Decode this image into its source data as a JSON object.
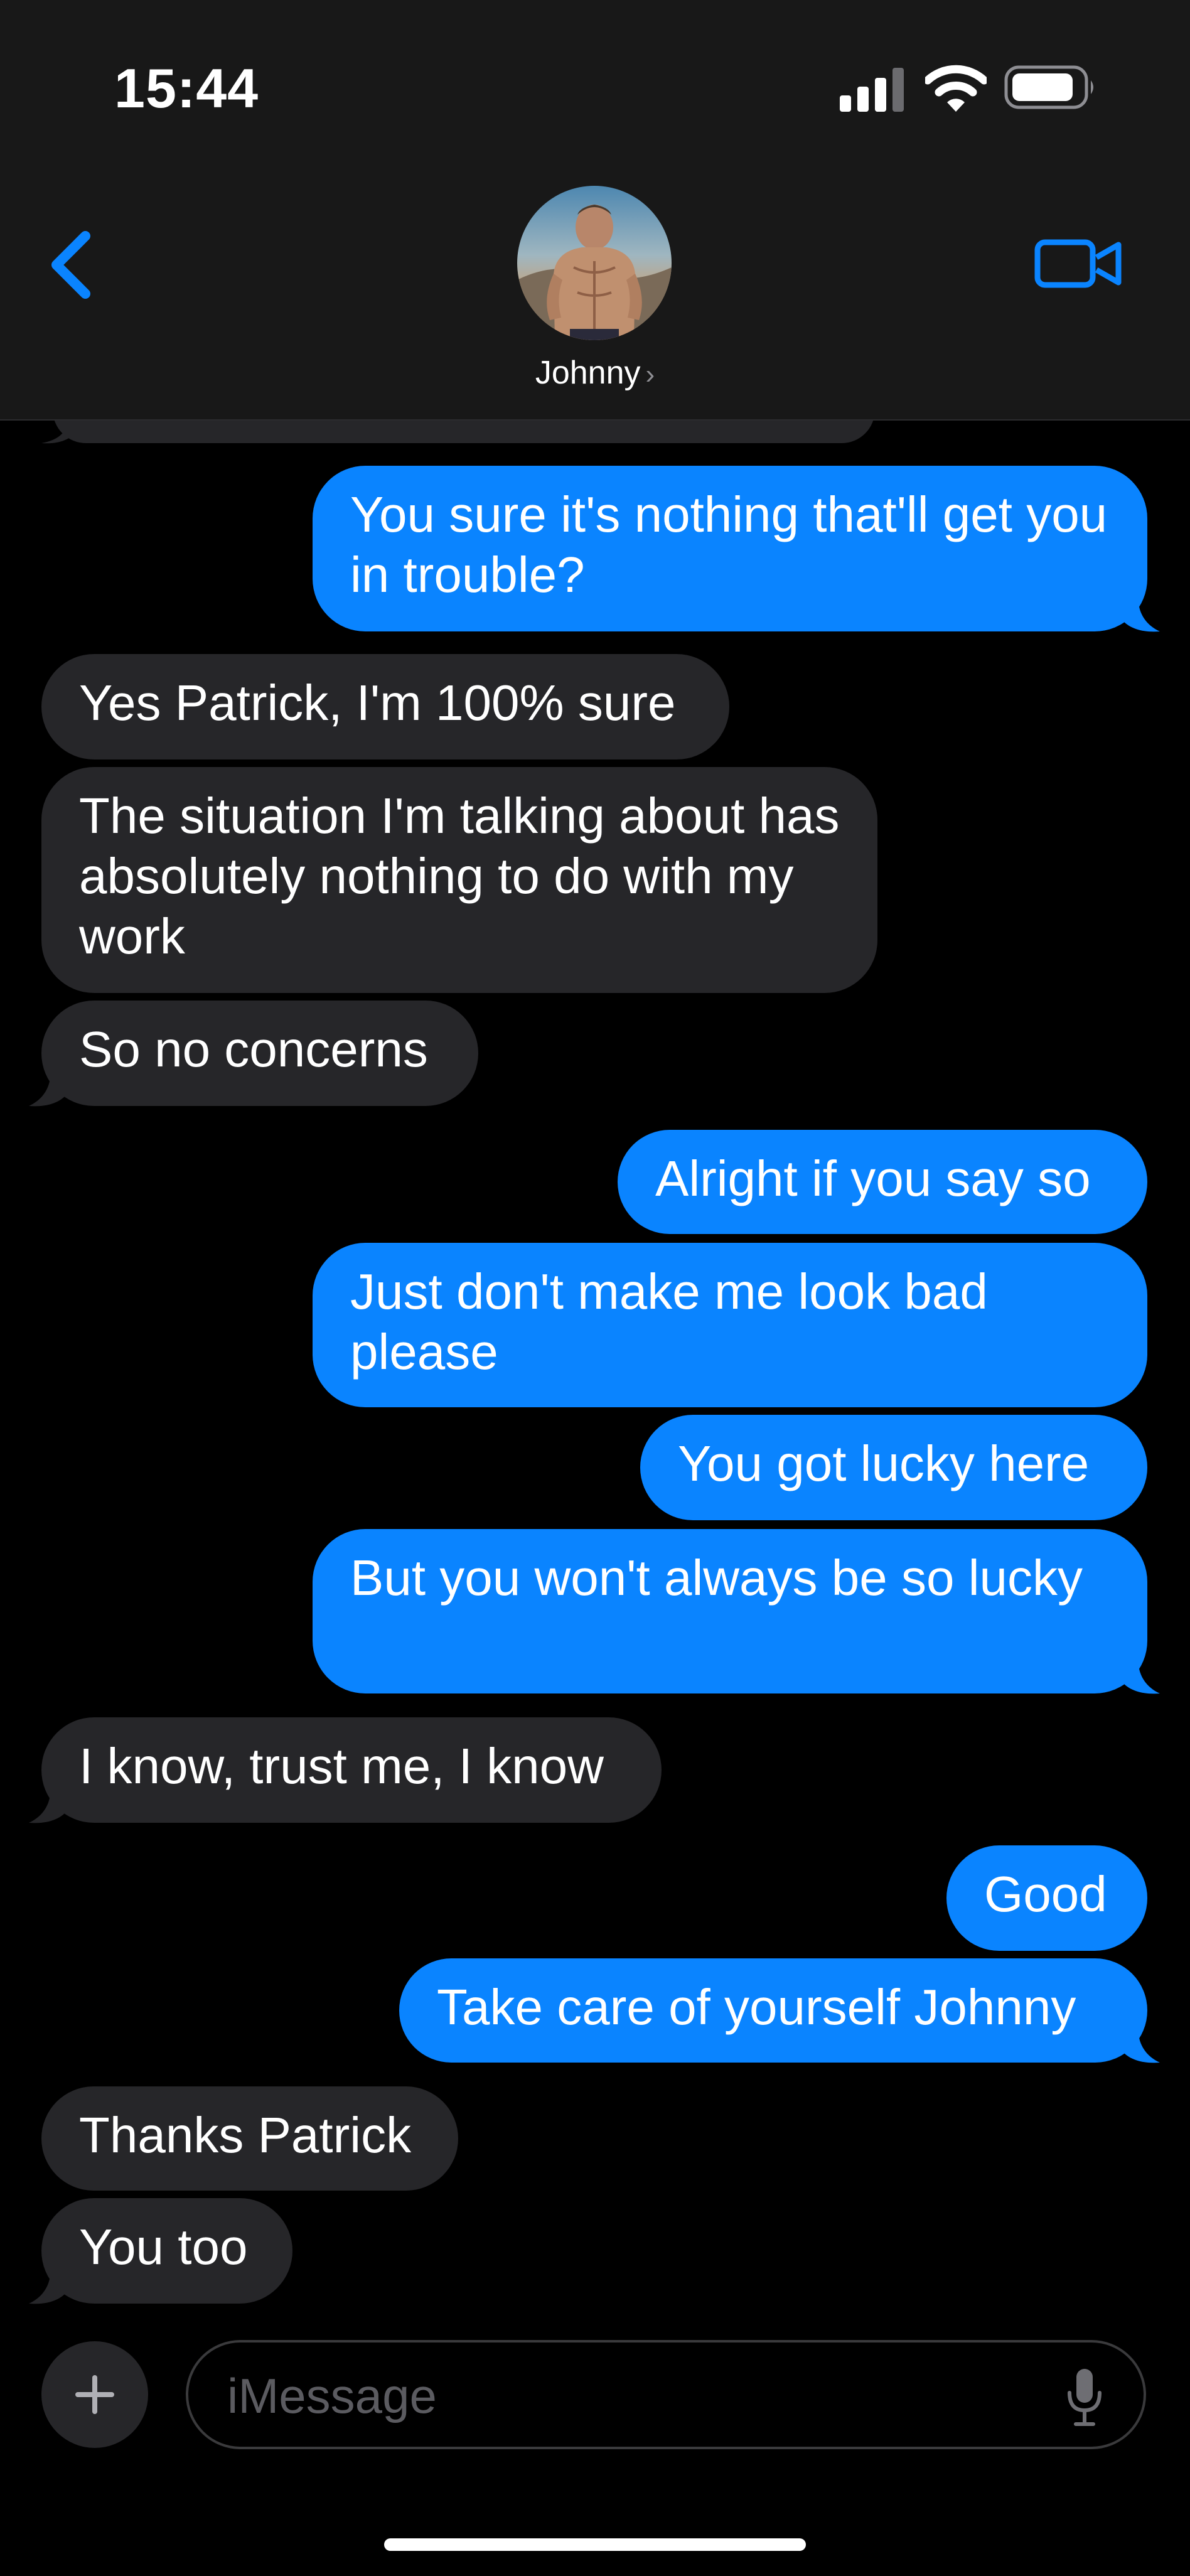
{
  "status_bar": {
    "time": "15:44"
  },
  "header": {
    "contact_name": "Johnny"
  },
  "messages": [
    {
      "dir": "out",
      "text": "You sure it's nothing that'll get you in trouble?"
    },
    {
      "dir": "in",
      "text": "Yes Patrick, I'm 100% sure"
    },
    {
      "dir": "in",
      "text": "The situation I'm talking about has absolutely nothing to do with my work"
    },
    {
      "dir": "in",
      "text": "So no concerns"
    },
    {
      "dir": "out",
      "text": "Alright if you say so"
    },
    {
      "dir": "out",
      "text": "Just don't make me look bad please"
    },
    {
      "dir": "out",
      "text": "You got lucky here"
    },
    {
      "dir": "out",
      "text": "But you won't always be so lucky"
    },
    {
      "dir": "in",
      "text": "I know, trust me, I know"
    },
    {
      "dir": "out",
      "text": "Good"
    },
    {
      "dir": "out",
      "text": "Take care of yourself Johnny"
    },
    {
      "dir": "in",
      "text": "Thanks Patrick"
    },
    {
      "dir": "in",
      "text": "You too"
    }
  ],
  "composer": {
    "placeholder": "iMessage"
  },
  "icons": {
    "back": "chevron-left-icon",
    "video": "video-camera-icon",
    "plus": "plus-icon",
    "mic": "microphone-icon"
  },
  "colors": {
    "accent": "#0a84ff",
    "incoming_bubble": "#262629",
    "header_bg": "#181818",
    "background": "#000000"
  }
}
